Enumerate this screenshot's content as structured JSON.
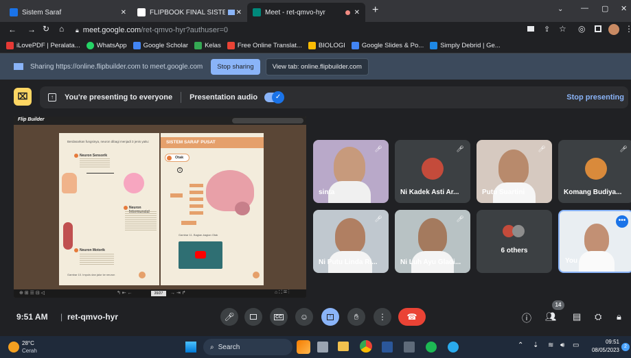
{
  "browser": {
    "tabs": [
      {
        "title": "Sistem Saraf",
        "color": "#1a73e8"
      },
      {
        "title": "FLIPBOOK FINAL SISTEM KO",
        "color": "#ffffff"
      },
      {
        "title": "Meet - ret-qmvo-hyr",
        "color": "#00897b"
      }
    ],
    "url_host": "meet.google.com",
    "url_path": "/ret-qmvo-hyr?authuser=0",
    "bookmarks": [
      {
        "label": "iLovePDF | Peralata...",
        "color": "#e53935"
      },
      {
        "label": "WhatsApp",
        "color": "#25d366"
      },
      {
        "label": "Google Scholar",
        "color": "#4285f4"
      },
      {
        "label": "Kelas",
        "color": "#34a853"
      },
      {
        "label": "Free Online Translat...",
        "color": "#ea4335"
      },
      {
        "label": "BIOLOGI",
        "color": "#fbbc04"
      },
      {
        "label": "Google Slides & Po...",
        "color": "#4285f4"
      },
      {
        "label": "Simply Debrid | Ge...",
        "color": "#1e88e5"
      }
    ]
  },
  "sharebar": {
    "text": "Sharing https://online.flipbuilder.com to meet.google.com",
    "stop_label": "Stop sharing",
    "view_label": "View tab: online.flipbuilder.com"
  },
  "presenting": {
    "text": "You're presenting to everyone",
    "audio_label": "Presentation audio",
    "stop_label": "Stop presenting"
  },
  "flipbook": {
    "brand": "Flip Builder",
    "left_intro": "Berdasarkan fungsinya, neuron dibagi menjadi 3 jenis yaitu:",
    "neuron1": "Neuron Sensorik",
    "neuron2": "Neuron Intermuncial",
    "neuron3": "Neuron Motorik",
    "left_caption": "Gambar 10. Impuls dan jalur ke neuron",
    "right_title": "SISTEM SARAF PUSAT",
    "otak_label": "Otak",
    "item1": "1",
    "right_caption": "Gambar 11. Bagian-bagian Otak",
    "page_box": "20/27"
  },
  "participants": [
    {
      "name": "sinta",
      "type": "video"
    },
    {
      "name": "Ni Kadek Asti Ar...",
      "type": "avatar"
    },
    {
      "name": "Putu Suartini",
      "type": "video"
    },
    {
      "name": "Komang Budiya...",
      "type": "avatar"
    },
    {
      "name": "Ni Putu Linda Ri...",
      "type": "video"
    },
    {
      "name": "Ni Luh Ayu Gladi...",
      "type": "video"
    },
    {
      "name": "6 others",
      "type": "others"
    },
    {
      "name": "You",
      "type": "self"
    }
  ],
  "controls": {
    "time": "9:51 AM",
    "meeting_code": "ret-qmvo-hyr",
    "people_count": "14"
  },
  "taskbar": {
    "temp": "28°C",
    "weather": "Cerah",
    "search_label": "Search",
    "clock_time": "09:51",
    "clock_date": "08/05/2023",
    "notif": "2"
  }
}
